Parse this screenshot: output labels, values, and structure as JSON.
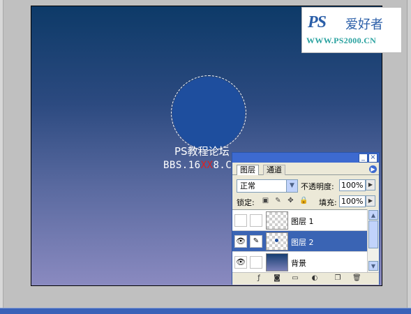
{
  "canvas": {
    "watermark_title": "PS教程论坛",
    "watermark_url_prefix": "BBS.16",
    "watermark_url_red": "XX",
    "watermark_url_suffix": "8.COM",
    "circle_color": "#1e4e9e"
  },
  "logo": {
    "ps_text": "PS",
    "cn_text": "爱好者",
    "url": "WWW.PS2000.CN"
  },
  "layers_panel": {
    "tabs": [
      {
        "label": "图层",
        "active": true
      },
      {
        "label": "通道",
        "active": false
      }
    ],
    "blend_mode": "正常",
    "opacity_label": "不透明度:",
    "opacity_value": "100%",
    "lock_label": "锁定:",
    "fill_label": "填充:",
    "fill_value": "100%",
    "layers": [
      {
        "name": "图层 1",
        "visible": false,
        "selected": false
      },
      {
        "name": "图层 2",
        "visible": true,
        "selected": true
      },
      {
        "name": "背景",
        "visible": true,
        "selected": false
      }
    ]
  },
  "colors": {
    "accent": "#3d6ad0",
    "selection": "#3a64b4"
  }
}
